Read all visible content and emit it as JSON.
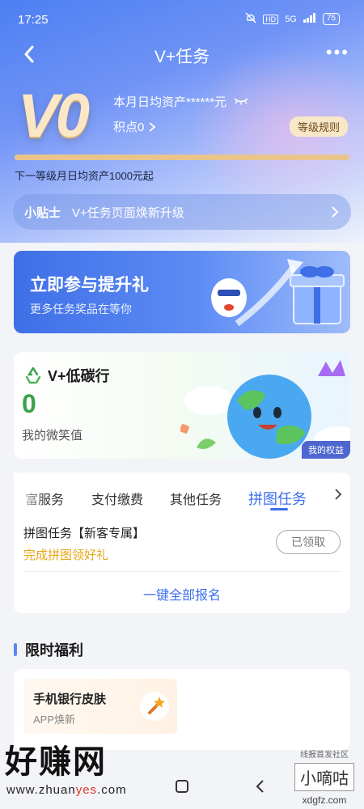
{
  "status_bar": {
    "time": "17:25",
    "network": "5G",
    "battery": "75"
  },
  "nav": {
    "title": "V+任务",
    "back_icon": "chevron-left-icon",
    "more_label": "•••"
  },
  "level": {
    "mark": "V0",
    "asset_text": "本月日均资产******元",
    "points_text": "积点0",
    "rule_button": "等级规则",
    "progress": 1.0,
    "next_level_text": "下一等级月日均资产1000元起"
  },
  "tip": {
    "label": "小贴士",
    "text": "V+任务页面焕新升级"
  },
  "banner": {
    "title": "立即参与提升礼",
    "subtitle": "更多任务奖品在等你"
  },
  "carbon": {
    "title": "V+低碳行",
    "value": "0",
    "label": "我的微笑值",
    "badge": "我的权益"
  },
  "tasks": {
    "tabs": [
      "富服务",
      "支付缴费",
      "其他任务",
      "拼图任务"
    ],
    "active_tab": "拼图任务",
    "item_name": "拼图任务【新客专属】",
    "item_desc": "完成拼图领好礼",
    "item_button": "已领取",
    "signup_all": "一键全部报名"
  },
  "welfare": {
    "section_title": "限时福利",
    "item_name": "手机银行皮肤",
    "item_sub": "APP焕新"
  },
  "watermarks": {
    "left_title": "好赚网",
    "left_url_prefix": "www.zhuan",
    "left_url_highlight": "yes",
    "left_url_suffix": ".com",
    "right_top": "线报首发社区",
    "right_mid": "小嘀咕",
    "right_bottom": "xdgfz.com"
  },
  "colors": {
    "accent": "#3d6ef0",
    "gold": "#e8a617",
    "green": "#3aa24a",
    "header": "#4d7ff2"
  }
}
